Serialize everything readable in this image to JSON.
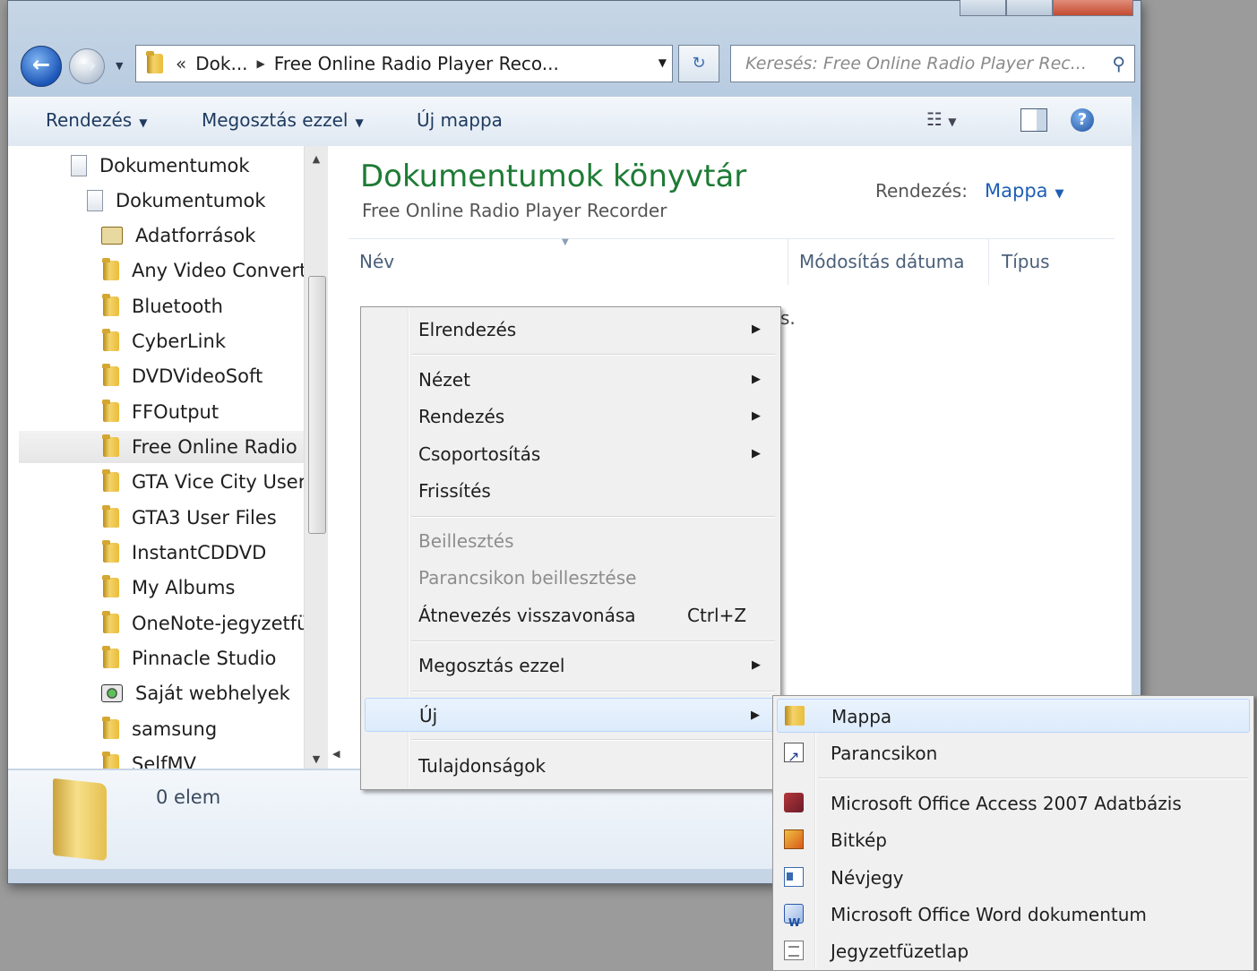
{
  "address": {
    "overflow": "«",
    "crumbs": [
      "Dok...",
      "Free Online Radio Player Reco..."
    ]
  },
  "search": {
    "placeholder": "Keresés: Free Online Radio Player Rec..."
  },
  "toolbar": {
    "organize": "Rendezés",
    "share": "Megosztás ezzel",
    "new_folder": "Új mappa"
  },
  "tree": {
    "items": [
      "Dokumentumok",
      "Dokumentumok",
      "Adatforrások",
      "Any Video Convert",
      "Bluetooth",
      "CyberLink",
      "DVDVideoSoft",
      "FFOutput",
      "Free Online Radio",
      "GTA Vice City User",
      "GTA3 User Files",
      "InstantCDDVD",
      "My Albums",
      "OneNote-jegyzetfü",
      "Pinnacle Studio",
      "Saját webhelyek",
      "samsung",
      "SelfMV"
    ]
  },
  "library": {
    "title": "Dokumentumok könyvtár",
    "subtitle": "Free Online Radio Player Recorder",
    "arrange_label": "Rendezés:",
    "arrange_value": "Mappa"
  },
  "columns": {
    "name": "Név",
    "modified": "Módosítás dátuma",
    "type": "Típus"
  },
  "empty_fragment": "s.",
  "details": {
    "count": "0 elem"
  },
  "context_menu": {
    "layout": "Elrendezés",
    "view": "Nézet",
    "sort": "Rendezés",
    "group": "Csoportosítás",
    "refresh": "Frissítés",
    "paste": "Beillesztés",
    "paste_shortcut": "Parancsikon beillesztése",
    "undo_rename": "Átnevezés visszavonása",
    "undo_shortcut": "Ctrl+Z",
    "share": "Megosztás ezzel",
    "new": "Új",
    "properties": "Tulajdonságok"
  },
  "new_submenu": {
    "folder": "Mappa",
    "shortcut": "Parancsikon",
    "access": "Microsoft Office Access 2007 Adatbázis",
    "bitmap": "Bitkép",
    "contact": "Névjegy",
    "word": "Microsoft Office Word dokumentum",
    "text": "Jegyzetfüzetlap"
  },
  "icons": {
    "back": "back-arrow-icon",
    "forward": "forward-arrow-icon",
    "search": "search-icon",
    "help": "help-icon",
    "folder": "folder-icon"
  }
}
